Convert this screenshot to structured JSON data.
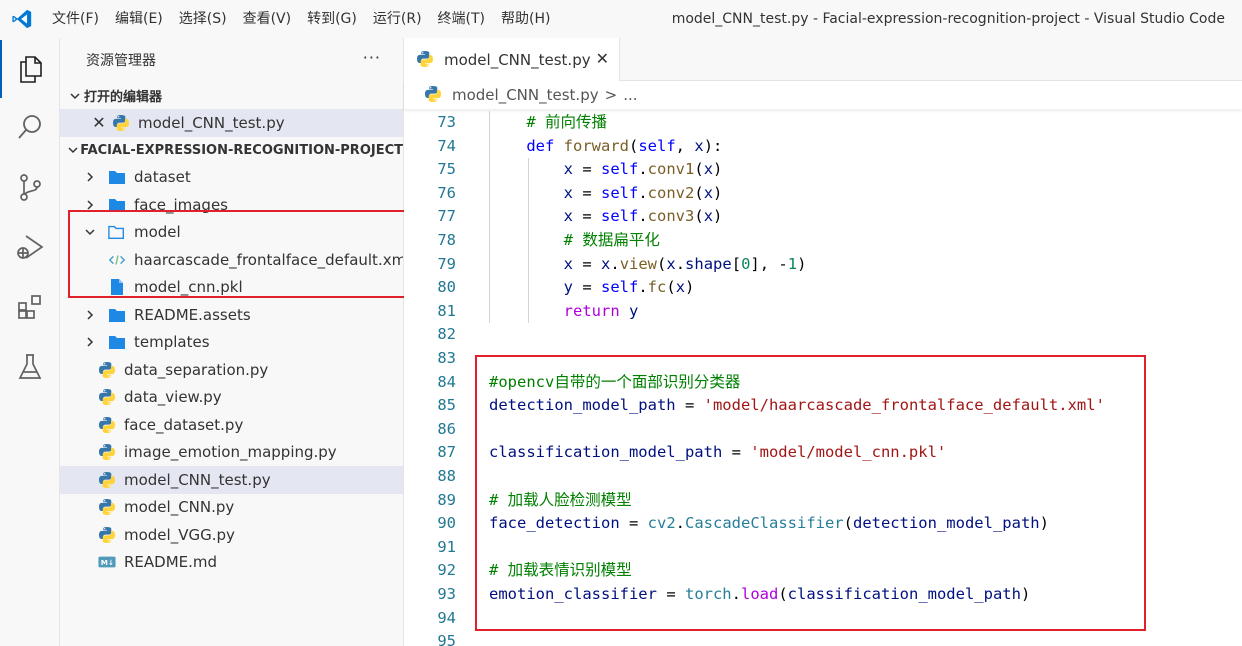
{
  "menu": [
    "文件(F)",
    "编辑(E)",
    "选择(S)",
    "查看(V)",
    "转到(G)",
    "运行(R)",
    "终端(T)",
    "帮助(H)"
  ],
  "window_title": "model_CNN_test.py - Facial-expression-recognition-project - Visual Studio Code",
  "sidebar": {
    "title": "资源管理器",
    "more": "···",
    "open_editors_label": "打开的编辑器",
    "open_editor_file": "model_CNN_test.py",
    "project_label": "FACIAL-EXPRESSION-RECOGNITION-PROJECT",
    "tree": [
      {
        "label": "dataset",
        "type": "folder"
      },
      {
        "label": "face_images",
        "type": "folder"
      },
      {
        "label": "model",
        "type": "folder-open"
      },
      {
        "label": "haarcascade_frontalface_default.xml",
        "type": "xml"
      },
      {
        "label": "model_cnn.pkl",
        "type": "file"
      },
      {
        "label": "README.assets",
        "type": "folder"
      },
      {
        "label": "templates",
        "type": "folder"
      },
      {
        "label": "data_separation.py",
        "type": "py"
      },
      {
        "label": "data_view.py",
        "type": "py"
      },
      {
        "label": "face_dataset.py",
        "type": "py"
      },
      {
        "label": "image_emotion_mapping.py",
        "type": "py"
      },
      {
        "label": "model_CNN_test.py",
        "type": "py"
      },
      {
        "label": "model_CNN.py",
        "type": "py"
      },
      {
        "label": "model_VGG.py",
        "type": "py"
      },
      {
        "label": "README.md",
        "type": "md"
      }
    ]
  },
  "editor": {
    "tab_label": "model_CNN_test.py",
    "breadcrumb_file": "model_CNN_test.py",
    "breadcrumb_sep": ">",
    "breadcrumb_more": "...",
    "line_numbers": [
      "73",
      "74",
      "75",
      "76",
      "77",
      "78",
      "79",
      "80",
      "81",
      "82",
      "83",
      "84",
      "85",
      "86",
      "87",
      "88",
      "89",
      "90",
      "91",
      "92",
      "93",
      "94",
      "95"
    ],
    "code_lines": [
      "    # 前向传播",
      "    def forward(self, x):",
      "        x = self.conv1(x)",
      "        x = self.conv2(x)",
      "        x = self.conv3(x)",
      "        # 数据扁平化",
      "        x = x.view(x.shape[0], -1)",
      "        y = self.fc(x)",
      "        return y",
      "",
      "",
      "#opencv自带的一个面部识别分类器",
      "detection_model_path = 'model/haarcascade_frontalface_default.xml'",
      "",
      "classification_model_path = 'model/model_cnn.pkl'",
      "",
      "# 加载人脸检测模型",
      "face_detection = cv2.CascadeClassifier(detection_model_path)",
      "",
      "# 加载表情识别模型",
      "emotion_classifier = torch.load(classification_model_path)",
      "",
      ""
    ]
  },
  "colors": {
    "accent": "#005fb8",
    "highlight_box": "#e0202a",
    "folder": "#1e88e5",
    "python_blue": "#3776ab",
    "python_yellow": "#ffd43b"
  }
}
